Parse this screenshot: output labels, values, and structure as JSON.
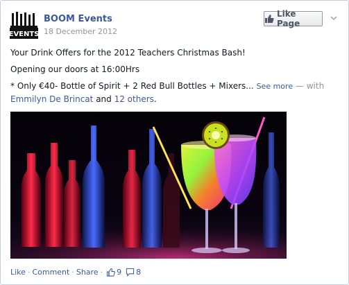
{
  "post": {
    "page_name": "BOOM Events",
    "logo_text": "EVENTS",
    "date": "18 December 2012",
    "like_page_label": "Like Page",
    "line1": "Your Drink Offers for the 2012 Teachers Christmas Bash!",
    "line2": "Opening our doors at 16:00Hrs",
    "line3_text": "* Only €40- Bottle of Spirit + 2 Red Bull Bottles + Mixers...",
    "see_more": "See more",
    "with_dash": "— with",
    "tagged_person": "Emmilyn De Brincat",
    "and_text": "and",
    "others_link": "12 others",
    "period": "."
  },
  "actions": {
    "like": "Like",
    "comment": "Comment",
    "share": "Share",
    "separator": "·",
    "likes_count": "9",
    "comments_count": "8"
  },
  "icons": {
    "like_page": "thumbs-up-icon",
    "menu": "chevron-down-icon",
    "likes": "thumbs-up-icon",
    "comments": "speech-bubble-icon"
  },
  "colors": {
    "link": "#3b5998",
    "muted": "#90949c",
    "text": "#141823",
    "border": "#c4cde0"
  }
}
